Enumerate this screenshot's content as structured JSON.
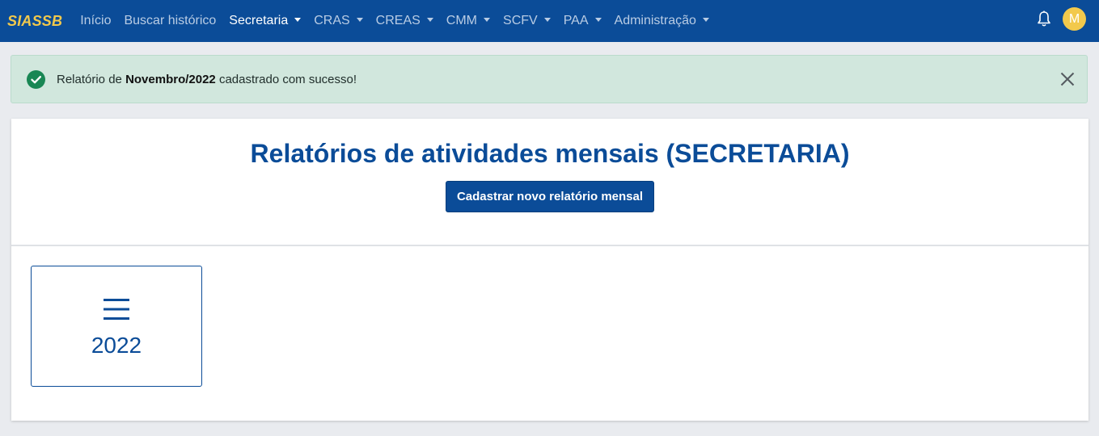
{
  "navbar": {
    "brand": "SIASSB",
    "items": [
      {
        "label": "Início",
        "dropdown": false,
        "active": false
      },
      {
        "label": "Buscar histórico",
        "dropdown": false,
        "active": false
      },
      {
        "label": "Secretaria",
        "dropdown": true,
        "active": true
      },
      {
        "label": "CRAS",
        "dropdown": true,
        "active": false
      },
      {
        "label": "CREAS",
        "dropdown": true,
        "active": false
      },
      {
        "label": "CMM",
        "dropdown": true,
        "active": false
      },
      {
        "label": "SCFV",
        "dropdown": true,
        "active": false
      },
      {
        "label": "PAA",
        "dropdown": true,
        "active": false
      },
      {
        "label": "Administração",
        "dropdown": true,
        "active": false
      }
    ],
    "avatar_initial": "M",
    "bell_icon": "bell-icon"
  },
  "alert": {
    "prefix": "Relatório de ",
    "highlight": "Novembro/2022",
    "suffix": " cadastrado com sucesso!",
    "icon": "check-circle-icon",
    "close_icon": "close-icon"
  },
  "main": {
    "title": "Relatórios de atividades mensais (SECRETARIA)",
    "new_button_label": "Cadastrar novo relatório mensal",
    "years": [
      {
        "label": "2022",
        "icon": "list-icon"
      }
    ]
  },
  "colors": {
    "primary": "#0b4c98",
    "brand": "#f2c94c",
    "success_bg": "#d1e7dd",
    "success_icon": "#198754"
  }
}
